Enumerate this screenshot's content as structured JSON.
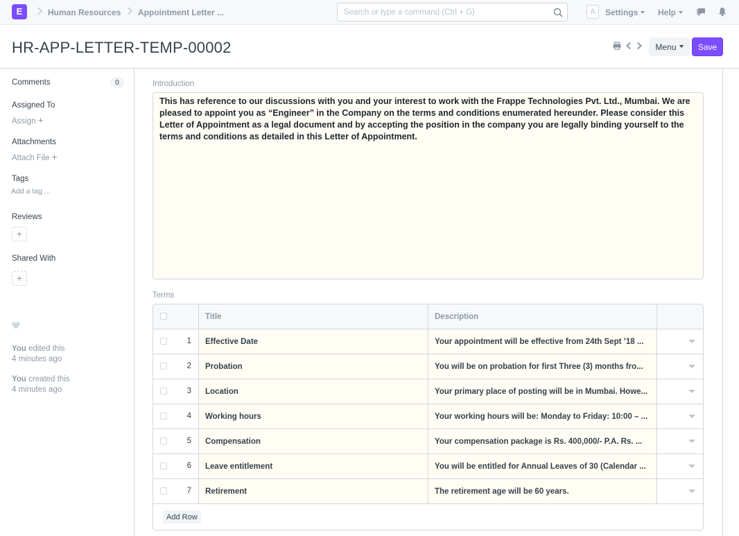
{
  "navbar": {
    "logo_letter": "E",
    "breadcrumbs": [
      {
        "label": "Human Resources"
      },
      {
        "label": "Appointment Letter ..."
      }
    ],
    "search_placeholder": "Search or type a command (Ctrl + G)",
    "avatar_letter": "A",
    "settings_label": "Settings",
    "help_label": "Help"
  },
  "page": {
    "title": "HR-APP-LETTER-TEMP-00002",
    "menu_label": "Menu",
    "save_label": "Save"
  },
  "sidebar": {
    "comments_label": "Comments",
    "comments_count": "0",
    "assigned_to_label": "Assigned To",
    "assign_link": "Assign",
    "attachments_label": "Attachments",
    "attach_link": "Attach File",
    "tags_label": "Tags",
    "add_tag_link": "Add a tag ...",
    "reviews_label": "Reviews",
    "shared_with_label": "Shared With",
    "activity": [
      {
        "actor": "You",
        "action": " edited this",
        "time": "4 minutes ago"
      },
      {
        "actor": "You",
        "action": " created this",
        "time": "4 minutes ago"
      }
    ]
  },
  "form": {
    "introduction_label": "Introduction",
    "introduction_text": "This has reference to our discussions with you and your interest to work with the Frappe Technologies Pvt. Ltd., Mumbai. We are pleased to appoint you as “Engineer” in the Company on the terms and conditions enumerated hereunder. Please consider this Letter of Appointment as a legal document and by accepting the position in the company you are legally binding yourself to the terms and conditions as detailed in this Letter of Appointment.",
    "terms_label": "Terms",
    "terms_columns": {
      "title": "Title",
      "description": "Description"
    },
    "terms_rows": [
      {
        "idx": "1",
        "title": "Effective Date",
        "description": "Your appointment will be effective from 24th Sept ’18 ..."
      },
      {
        "idx": "2",
        "title": "Probation",
        "description": "You will be on probation for first Three (3) months fro..."
      },
      {
        "idx": "3",
        "title": "Location",
        "description": "Your primary place of posting will be in Mumbai. Howe..."
      },
      {
        "idx": "4",
        "title": "Working hours",
        "description": "Your working hours will be: Monday to Friday: 10:00 – ..."
      },
      {
        "idx": "5",
        "title": "Compensation",
        "description": "Your compensation package is Rs. 400,000/- P.A. Rs. ..."
      },
      {
        "idx": "6",
        "title": "Leave entitlement",
        "description": "You will be entitled for Annual Leaves of 30 (Calendar ..."
      },
      {
        "idx": "7",
        "title": "Retirement",
        "description": "The retirement age will be 60 years."
      }
    ],
    "add_row_label": "Add Row"
  }
}
